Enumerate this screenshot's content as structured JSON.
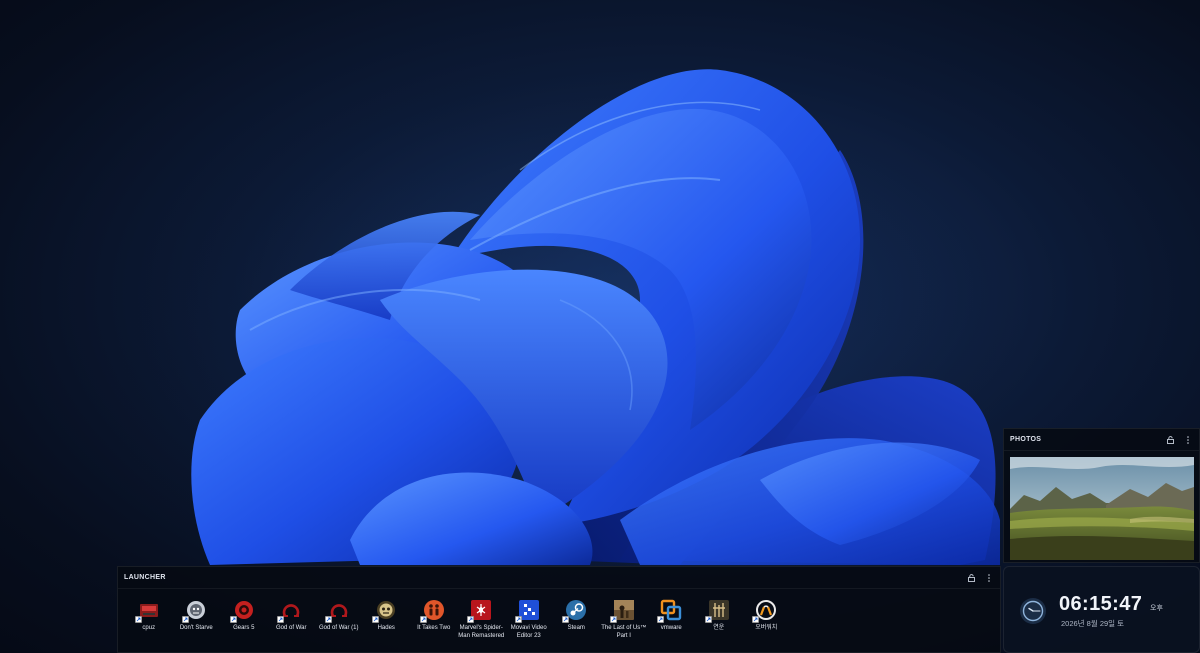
{
  "launcher": {
    "title": "LAUNCHER",
    "apps": [
      {
        "label": "cpuz",
        "icon": "cpuz-icon",
        "color": "#8a1c1c"
      },
      {
        "label": "Don't Starve",
        "icon": "dont-starve-icon",
        "color": "#c9cfd8"
      },
      {
        "label": "Gears 5",
        "icon": "gears5-icon",
        "color": "#c4201f"
      },
      {
        "label": "God of War",
        "icon": "god-of-war-icon",
        "color": "#b0181c"
      },
      {
        "label": "God of War (1)",
        "icon": "god-of-war-icon",
        "color": "#b0181c"
      },
      {
        "label": "Hades",
        "icon": "hades-icon",
        "color": "#7a6a3a"
      },
      {
        "label": "It Takes Two",
        "icon": "it-takes-two-icon",
        "color": "#e0562a"
      },
      {
        "label": "Marvel's Spider-Man Remastered",
        "icon": "spiderman-icon",
        "color": "#b8161c"
      },
      {
        "label": "Movavi Video Editor 23",
        "icon": "movavi-icon",
        "color": "#1f4fd8"
      },
      {
        "label": "Steam",
        "icon": "steam-icon",
        "color": "#2a6fa8"
      },
      {
        "label": "The Last of Us™ Part I",
        "icon": "last-of-us-icon",
        "color": "#6b5233"
      },
      {
        "label": "vmware",
        "icon": "vmware-icon",
        "color": "#f0901e"
      },
      {
        "label": "연운",
        "icon": "yeonun-icon",
        "color": "#3a3528"
      },
      {
        "label": "오버워치",
        "icon": "overwatch-icon",
        "color": "#eaeaea"
      }
    ]
  },
  "photos": {
    "title": "PHOTOS"
  },
  "clock": {
    "time": "06:15:47",
    "ampm": "오후",
    "date": "2026년 8월 29일 토"
  }
}
